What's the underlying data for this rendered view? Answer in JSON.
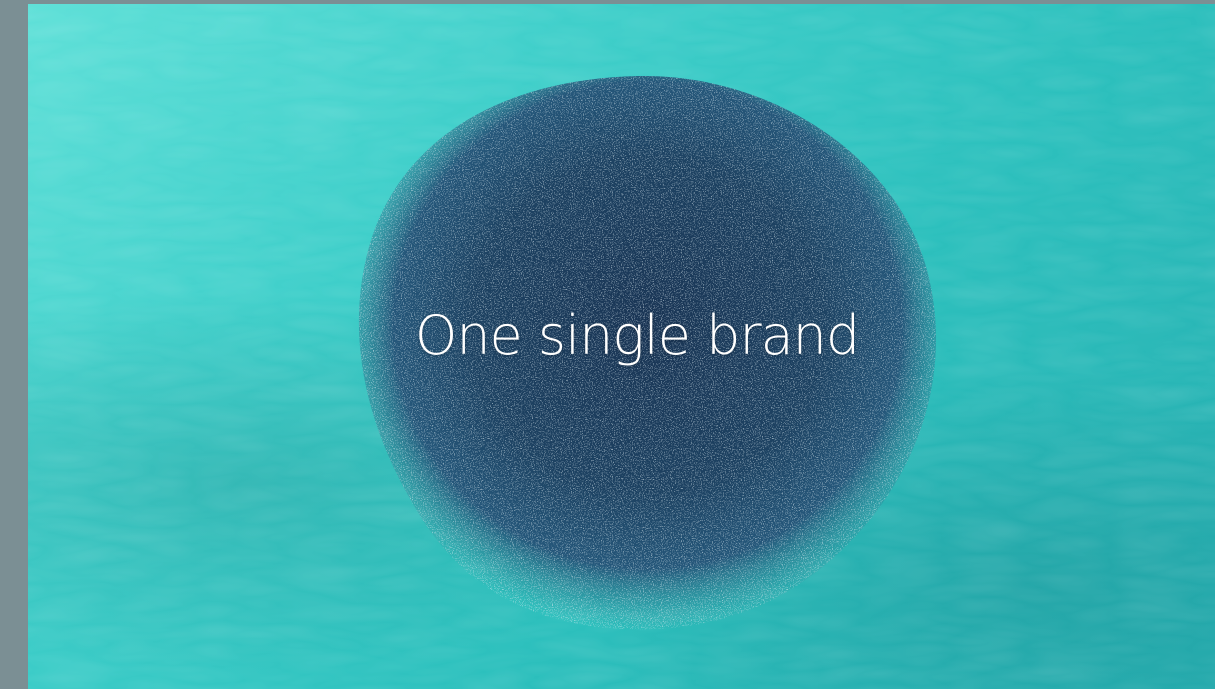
{
  "hero": {
    "headline": "One single brand",
    "colors": {
      "water_light": "#5fe0d8",
      "water_dark": "#25aeb0",
      "school_core": "#1d3f5e",
      "school_edge": "#2c6d80",
      "frame": "#7b8f94"
    },
    "image_subject": "school-of-fish-in-ocean"
  }
}
